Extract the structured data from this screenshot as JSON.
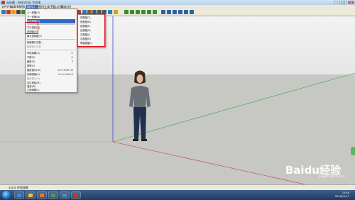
{
  "window": {
    "title": "无标题 - SketchUp 专业版",
    "buttons": {
      "minimize": "–",
      "maximize": "□",
      "close": "✕"
    }
  },
  "menubar": {
    "items": [
      "文件(F)",
      "编辑(E)",
      "视图(V)",
      "相机(C)",
      "绘图(R)",
      "工具(T)",
      "窗口(W)",
      "帮助(H)"
    ],
    "active_index": 3
  },
  "dropdown": {
    "items": [
      {
        "label": "上一视图(P)",
        "shortcut": "",
        "disabled": false
      },
      {
        "label": "下一视图(N)",
        "shortcut": "",
        "disabled": false
      },
      {
        "label": "标准视图(S)",
        "shortcut": "",
        "submenu": true,
        "disabled": false
      },
      {
        "label": "平行投影(A)",
        "shortcut": "",
        "disabled": false
      },
      {
        "label": "透视图(E)",
        "shortcut": "",
        "disabled": false
      },
      {
        "label": "两点透视图(T)",
        "shortcut": "",
        "disabled": false
      },
      {
        "label": "新建照片匹配...",
        "shortcut": "",
        "disabled": false
      },
      {
        "label": "编辑照片匹配",
        "shortcut": "",
        "disabled": true
      },
      {
        "label": "环绕观察(O)",
        "shortcut": "O",
        "disabled": false
      },
      {
        "label": "平移(P)",
        "shortcut": "H",
        "disabled": false
      },
      {
        "label": "缩放(Z)",
        "shortcut": "Z",
        "disabled": false
      },
      {
        "label": "视野(F)",
        "shortcut": "",
        "disabled": false
      },
      {
        "label": "缩放窗口(W)",
        "shortcut": "Ctrl+Shift+W",
        "disabled": false
      },
      {
        "label": "充满视窗(E)",
        "shortcut": "Ctrl+Shift+E",
        "disabled": false
      },
      {
        "label": "缩放照片(H)",
        "shortcut": "",
        "disabled": true
      },
      {
        "label": "定位相机(M)",
        "shortcut": "",
        "disabled": false
      },
      {
        "label": "漫游(W)",
        "shortcut": "",
        "disabled": false
      },
      {
        "label": "正面观察(L)",
        "shortcut": "",
        "disabled": false
      },
      {
        "label": "图像编辑器(I)",
        "shortcut": "",
        "disabled": false
      }
    ]
  },
  "submenu": {
    "items": [
      "顶视图(T)",
      "底视图(B)",
      "前视图(F)",
      "后视图(K)",
      "左视图(L)",
      "右视图(R)",
      "等轴视图(I)"
    ]
  },
  "statusbar": {
    "text": "①②③  环绕观察"
  },
  "taskbar": {
    "clock_time": "13:48",
    "clock_date": "2016/11/11"
  },
  "watermark": {
    "brand": "Baidu经验",
    "url": "jingyan.baidu.com"
  },
  "colors": {
    "highlight_box": "#e0141e",
    "axis_green": "#3aa53a",
    "axis_red": "#c0392b",
    "axis_blue": "#3b4bd0"
  }
}
